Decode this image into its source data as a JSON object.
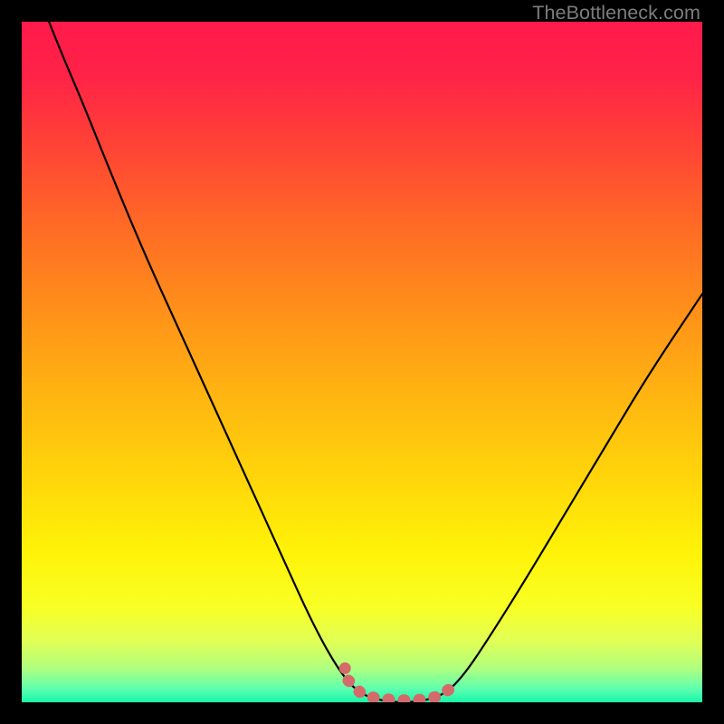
{
  "watermark": "TheBottleneck.com",
  "gradient": {
    "stops": [
      {
        "offset": 0.0,
        "color": "#ff1a4b"
      },
      {
        "offset": 0.08,
        "color": "#ff2347"
      },
      {
        "offset": 0.18,
        "color": "#ff4236"
      },
      {
        "offset": 0.3,
        "color": "#ff6a25"
      },
      {
        "offset": 0.42,
        "color": "#ff8f1a"
      },
      {
        "offset": 0.55,
        "color": "#ffb511"
      },
      {
        "offset": 0.68,
        "color": "#ffd80a"
      },
      {
        "offset": 0.78,
        "color": "#fff308"
      },
      {
        "offset": 0.86,
        "color": "#f8ff25"
      },
      {
        "offset": 0.91,
        "color": "#e1ff55"
      },
      {
        "offset": 0.95,
        "color": "#b0ff7e"
      },
      {
        "offset": 0.98,
        "color": "#5fffb0"
      },
      {
        "offset": 1.0,
        "color": "#18f6a8"
      }
    ]
  },
  "chart_data": {
    "type": "line",
    "title": "",
    "xlabel": "",
    "ylabel": "",
    "xlim": [
      0,
      100
    ],
    "ylim": [
      0,
      100
    ],
    "series": [
      {
        "name": "curve",
        "points": [
          {
            "x": 4,
            "y": 100
          },
          {
            "x": 6,
            "y": 95
          },
          {
            "x": 9,
            "y": 88
          },
          {
            "x": 13,
            "y": 78
          },
          {
            "x": 18,
            "y": 66
          },
          {
            "x": 23,
            "y": 55
          },
          {
            "x": 28,
            "y": 44
          },
          {
            "x": 33,
            "y": 33
          },
          {
            "x": 38,
            "y": 22
          },
          {
            "x": 43,
            "y": 11
          },
          {
            "x": 47,
            "y": 4
          },
          {
            "x": 50,
            "y": 1
          },
          {
            "x": 54,
            "y": 0
          },
          {
            "x": 58,
            "y": 0
          },
          {
            "x": 62,
            "y": 1
          },
          {
            "x": 65,
            "y": 4
          },
          {
            "x": 69,
            "y": 10
          },
          {
            "x": 74,
            "y": 18
          },
          {
            "x": 80,
            "y": 28
          },
          {
            "x": 86,
            "y": 38
          },
          {
            "x": 92,
            "y": 48
          },
          {
            "x": 100,
            "y": 60
          }
        ]
      },
      {
        "name": "highlight",
        "style": "thick-dashed-pink",
        "points": [
          {
            "x": 48,
            "y": 3.2
          },
          {
            "x": 50,
            "y": 1.2
          },
          {
            "x": 52,
            "y": 0.6
          },
          {
            "x": 55,
            "y": 0.3
          },
          {
            "x": 58,
            "y": 0.3
          },
          {
            "x": 61,
            "y": 0.8
          },
          {
            "x": 63,
            "y": 2.0
          },
          {
            "x": 64,
            "y": 3.2
          }
        ]
      }
    ],
    "highlight_dots": [
      {
        "x": 47.5,
        "y": 5
      }
    ]
  }
}
